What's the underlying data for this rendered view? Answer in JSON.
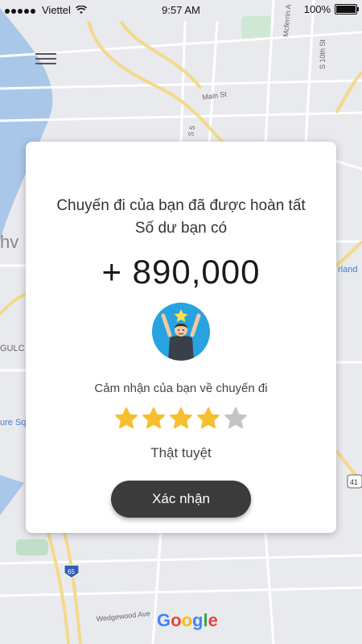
{
  "status_bar": {
    "carrier": "Viettel",
    "time": "9:57 AM",
    "battery": "100%"
  },
  "map": {
    "labels": {
      "main_st": "Main St",
      "s_10th_st": "S 10th St",
      "mcferrin_av": "Mcferrin A",
      "s5": "S 5",
      "edgewood": "Wedgewood Ave",
      "rland": "rland",
      "hv": "hv",
      "gulc": "GULC",
      "ure_sq": "ure Sq",
      "highway_65": "65",
      "highway_41": "41"
    },
    "brand": "Google"
  },
  "dialog": {
    "line1": "Chuyến đi của bạn đã được hoàn tất",
    "line2": "Số dư bạn có",
    "amount": "+ 890,000",
    "feedback_prompt": "Cảm nhận của bạn về chuyến đi",
    "rating": 4,
    "rating_max": 5,
    "rating_text": "Thật tuyệt",
    "confirm_label": "Xác nhận"
  },
  "colors": {
    "star_filled": "#f7be2f",
    "star_empty": "#c4c4c4",
    "button": "#3b3b3b",
    "avatar_bg": "#27a3e1"
  }
}
